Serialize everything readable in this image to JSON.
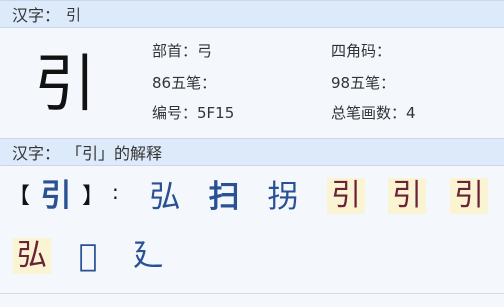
{
  "header": {
    "label": "汉字：",
    "char": "引"
  },
  "main": {
    "big_char": "引",
    "fields": {
      "radical": "部首：弓",
      "sijiao": "四角码：",
      "wubi86": "86五笔：",
      "wubi98": "98五笔：",
      "code": "编号：5F15",
      "strokes": "总笔画数：4"
    }
  },
  "section2": {
    "label": "汉字：",
    "title": "「引」的解释"
  },
  "definition": {
    "open_bracket": "【",
    "char": "引",
    "close_bracket": "】",
    "colon": ":",
    "variants": [
      "弘",
      "扫",
      "拐",
      "引",
      "引",
      "引",
      "弘",
      "𥓂",
      "廴"
    ]
  }
}
